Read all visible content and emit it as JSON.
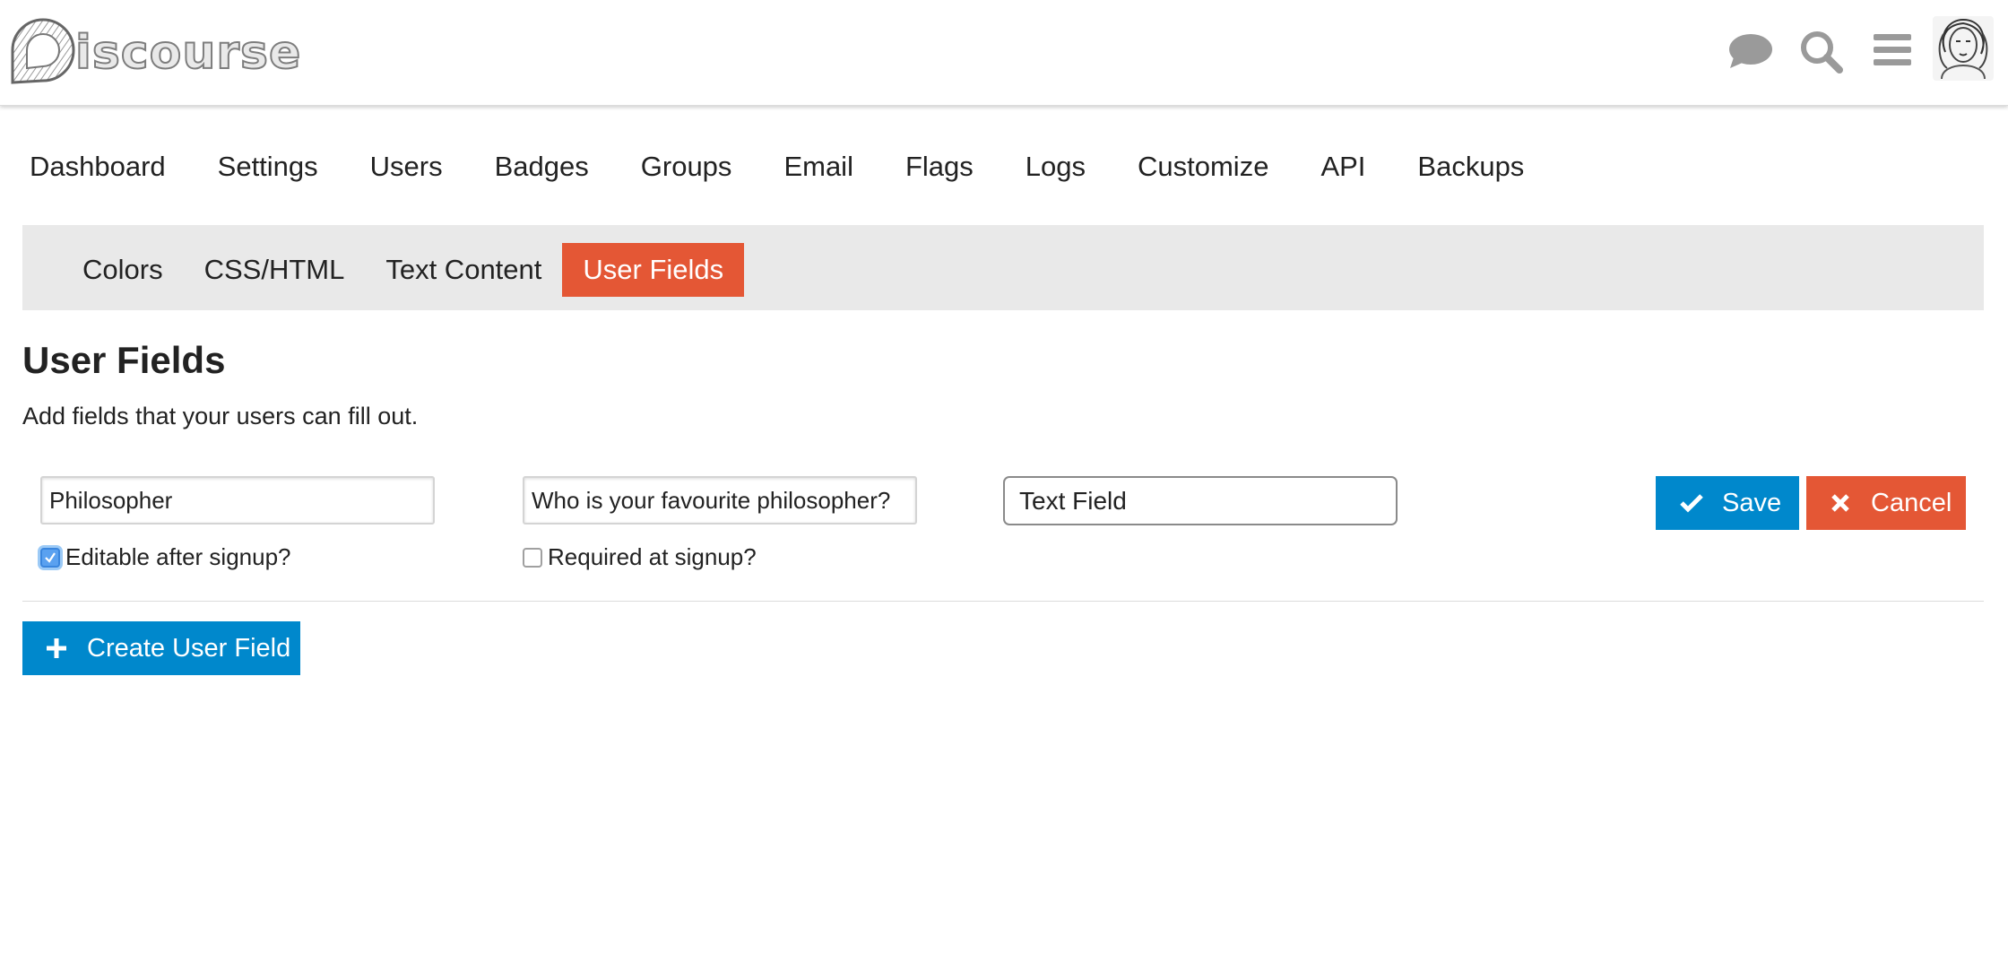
{
  "header": {
    "logo_text": "Discourse",
    "icons": [
      "chat-bubble-icon",
      "search-icon",
      "hamburger-menu-icon"
    ],
    "avatar": "user-avatar"
  },
  "main_nav": [
    "Dashboard",
    "Settings",
    "Users",
    "Badges",
    "Groups",
    "Email",
    "Flags",
    "Logs",
    "Customize",
    "API",
    "Backups"
  ],
  "sub_nav": {
    "tabs": [
      "Colors",
      "CSS/HTML",
      "Text Content",
      "User Fields"
    ],
    "active": "User Fields"
  },
  "page": {
    "title": "User Fields",
    "description": "Add fields that your users can fill out."
  },
  "field_form": {
    "name_value": "Philosopher",
    "description_value": "Who is your favourite philosopher?",
    "type_value": "Text Field",
    "editable_label": "Editable after signup?",
    "editable_checked": true,
    "required_label": "Required at signup?",
    "required_checked": false,
    "save_label": "Save",
    "cancel_label": "Cancel"
  },
  "create_button_label": "Create User Field",
  "colors": {
    "primary_blue": "#0088cc",
    "danger_orange": "#e45735",
    "subnav_bg": "#e9e9e9"
  }
}
